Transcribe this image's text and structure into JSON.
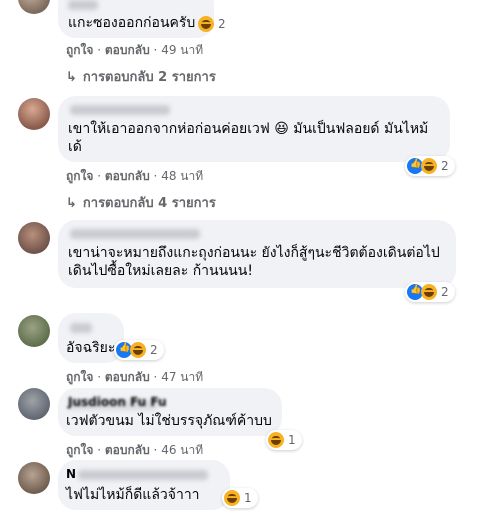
{
  "comments": [
    {
      "text": "แกะซองออกก่อนครับ",
      "reaction_count": "2",
      "actions": {
        "like": "ถูกใจ",
        "reply": "ตอบกลับ",
        "time": "49 นาที"
      },
      "replies_link": "การตอบกลับ 2 รายการ"
    },
    {
      "lines": [
        "เขาให้เอาออกจากห่อก่อนค่อยเวฟ 😆 มันเป็นฟลอยด์ มันไหม้",
        "เด้"
      ],
      "reaction_count": "2",
      "actions": {
        "like": "ถูกใจ",
        "reply": "ตอบกลับ",
        "time": "48 นาที"
      },
      "replies_link": "การตอบกลับ 4 รายการ"
    },
    {
      "lines": [
        "เขาน่าจะหมายถึงแกะถุงก่อนนะ ยังไงก็สู้ๆนะชีวิตต้องเดินต่อไป",
        "เดินไปซื้อใหม่เลยละ ก้านนนน!"
      ],
      "reaction_count": "2",
      "actions": {
        "like": "ถูกใจ",
        "reply": "ตอบกลับ",
        "time": "48 นาที"
      }
    },
    {
      "text": "อัจฉริยะ",
      "reaction_count": "2",
      "actions": {
        "like": "ถูกใจ",
        "reply": "ตอบกลับ",
        "time": "47 นาที"
      }
    },
    {
      "name": "Jusdioon Fu Fu",
      "text": "เวฟตัวขนม ไม่ใช่บรรจุภัณฑ์ค้าบบ",
      "reaction_count": "1",
      "actions": {
        "like": "ถูกใจ",
        "reply": "ตอบกลับ",
        "time": "46 นาที"
      }
    },
    {
      "name": "N",
      "text": "ไฟไม่ไหม้ก็ดีแล้วจ้าาา",
      "reaction_count": "1"
    }
  ],
  "colors": {
    "bubble": "#f0f2f5",
    "meta": "#65676b",
    "like_blue": "#1877f2",
    "haha": "#f7b125"
  },
  "icons": [
    "haha-reaction-icon",
    "like-reaction-icon",
    "reply-arrow-icon"
  ]
}
